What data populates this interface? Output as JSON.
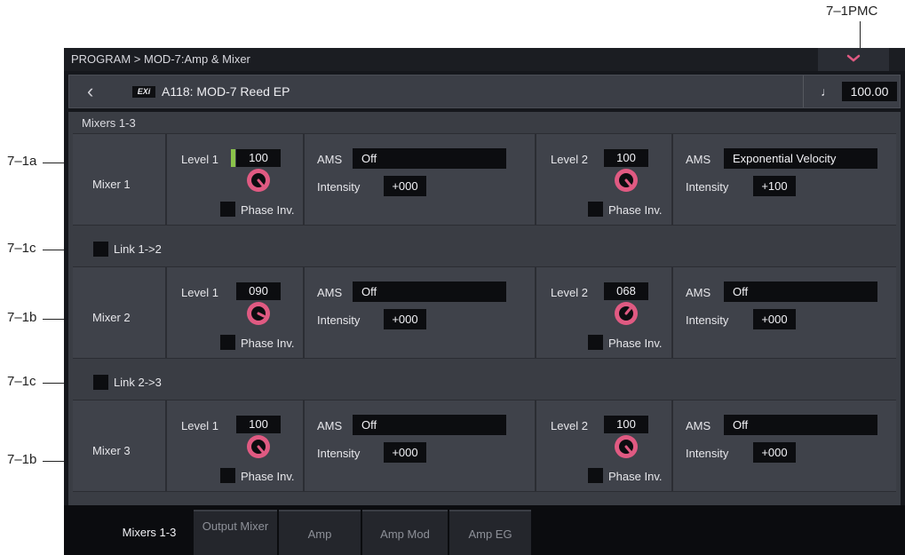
{
  "callouts": {
    "pmc": "7–1PMC",
    "mixer1": "7–1a",
    "link1": "7–1c",
    "mixer2": "7–1b",
    "link2": "7–1c",
    "mixer3": "7–1b"
  },
  "titlebar": {
    "title": "PROGRAM > MOD-7:Amp & Mixer",
    "menu_icon": "chevron-down-icon"
  },
  "program": {
    "back_icon": "back-arrow-icon",
    "exi_badge": "EXi",
    "name": "A118: MOD-7 Reed EP",
    "note_icon": "quarter-note-icon",
    "tempo": "100.00"
  },
  "panel": {
    "title": "Mixers 1-3"
  },
  "common": {
    "level1_label": "Level 1",
    "level2_label": "Level 2",
    "ams_label": "AMS",
    "intensity_label": "Intensity",
    "phase_label": "Phase Inv."
  },
  "mixers": [
    {
      "label": "Mixer 1",
      "level1": "100",
      "level2": "100",
      "ams1": "Off",
      "int1": "+000",
      "ams2": "Exponential Velocity",
      "int2": "+100"
    },
    {
      "label": "Mixer 2",
      "level1": "090",
      "level2": "068",
      "ams1": "Off",
      "int1": "+000",
      "ams2": "Off",
      "int2": "+000"
    },
    {
      "label": "Mixer 3",
      "level1": "100",
      "level2": "100",
      "ams1": "Off",
      "int1": "+000",
      "ams2": "Off",
      "int2": "+000"
    }
  ],
  "links": [
    "Link 1->2",
    "Link 2->3"
  ],
  "tabs": [
    {
      "label": "Mixers 1-3",
      "active": true
    },
    {
      "label": "Output Mixer",
      "active": false
    },
    {
      "label": "Amp",
      "active": false
    },
    {
      "label": "Amp Mod",
      "active": false
    },
    {
      "label": "Amp EG",
      "active": false
    }
  ],
  "colors": {
    "knob_accent": "#e05a82",
    "meter_green": "#8ac34a",
    "screen_bg": "#15171c"
  }
}
